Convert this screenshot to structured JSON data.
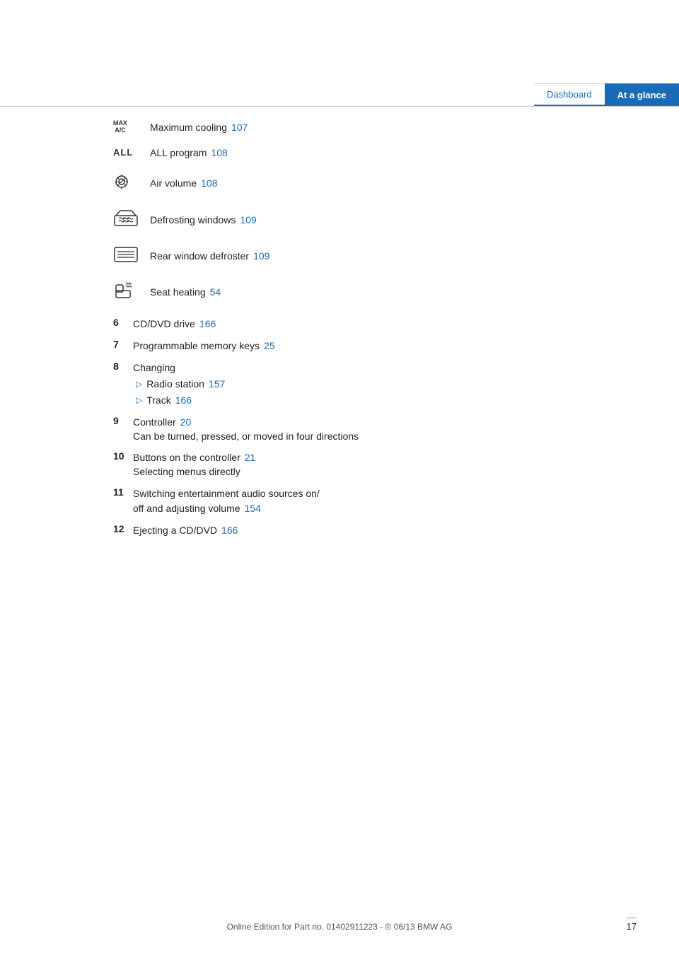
{
  "header": {
    "tab_dashboard": "Dashboard",
    "tab_at_a_glance": "At a glance"
  },
  "icon_rows": [
    {
      "icon_type": "max_ac",
      "label": "Maximum cooling",
      "page_ref": "107"
    },
    {
      "icon_type": "all",
      "label": "ALL program",
      "page_ref": "108"
    },
    {
      "icon_type": "air_volume",
      "label": "Air volume",
      "page_ref": "108"
    },
    {
      "icon_type": "defrost_windows",
      "label": "Defrosting windows",
      "page_ref": "109"
    },
    {
      "icon_type": "rear_defroster",
      "label": "Rear window defroster",
      "page_ref": "109"
    },
    {
      "icon_type": "seat_heating",
      "label": "Seat heating",
      "page_ref": "54"
    }
  ],
  "numbered_items": [
    {
      "num": "6",
      "label": "CD/DVD drive",
      "page_ref": "166",
      "sub_items": [],
      "desc": ""
    },
    {
      "num": "7",
      "label": "Programmable memory keys",
      "page_ref": "25",
      "sub_items": [],
      "desc": ""
    },
    {
      "num": "8",
      "label": "Changing",
      "page_ref": "",
      "sub_items": [
        {
          "label": "Radio station",
          "page_ref": "157"
        },
        {
          "label": "Track",
          "page_ref": "166"
        }
      ],
      "desc": ""
    },
    {
      "num": "9",
      "label": "Controller",
      "page_ref": "20",
      "sub_items": [],
      "desc": "Can be turned, pressed, or moved in four directions"
    },
    {
      "num": "10",
      "label": "Buttons on the controller",
      "page_ref": "21",
      "sub_items": [],
      "desc": "Selecting menus directly"
    },
    {
      "num": "11",
      "label": "Switching entertainment audio sources on/\noff and adjusting volume",
      "page_ref": "154",
      "sub_items": [],
      "desc": ""
    },
    {
      "num": "12",
      "label": "Ejecting a CD/DVD",
      "page_ref": "166",
      "sub_items": [],
      "desc": ""
    }
  ],
  "footer": {
    "text": "Online Edition for Part no. 01402911223 - © 06/13 BMW AG"
  },
  "page_number": "17"
}
